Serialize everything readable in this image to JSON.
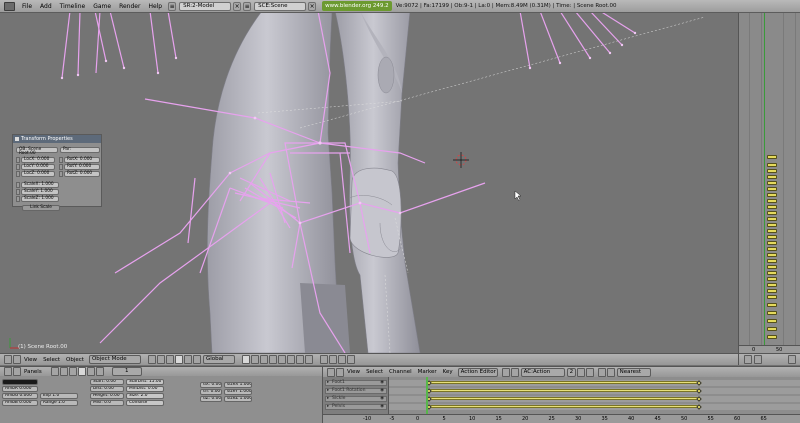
{
  "topbar": {
    "menus": [
      "File",
      "Add",
      "Timeline",
      "Game",
      "Render",
      "Help"
    ],
    "screen_field": "SR:2-Model",
    "scene_field": "SCE:Scene",
    "site_link": "www.blender.org 249.2",
    "stats": "Ve:9072 | Fa:17199 | Ob:9-1 | La:0 | Mem:8.49M (0.31M) | Time: | Scene Root.00"
  },
  "viewport": {
    "label": "(1) Scene Root.00",
    "transform_panel": {
      "title": "Transform Properties",
      "ob_label": "OB: Scene Root.00",
      "par_label": "Par:",
      "loc": [
        "LocX: 0.000",
        "LocY: 0.000",
        "LocZ: 0.000"
      ],
      "rot": [
        "RotX: 0.000",
        "RotY: 0.000",
        "RotZ: 0.000"
      ],
      "scale": [
        "ScaleX: 1.000",
        "ScaleY: 1.000",
        "ScaleZ: 1.000"
      ],
      "link_scale": "Link Scale"
    }
  },
  "view_header": {
    "menus": [
      "View",
      "Select",
      "Object"
    ],
    "mode": "Object Mode",
    "orientation": "Global"
  },
  "right_strip": {
    "axis_labels": [
      "0",
      "50"
    ]
  },
  "buttons_window": {
    "menu": "Panels",
    "frame_field": "1",
    "fields": [
      "AmbR 0.000",
      "AmbG 0.000",
      "AmbB 0.000",
      "Exp 1.0",
      "Range 1.0",
      "Start: 0.00",
      "Dist: 0.00",
      "Height: 0.00",
      "Misi: 0.0",
      "StarDist: 15.00",
      "MinDist: 0.00",
      "Size: 2.0",
      "Colnoise",
      "dX: 0.00",
      "dY: 0.00",
      "dZ: 0.00",
      "sizeX 1.000",
      "sizeY 1.000",
      "sizeZ 1.000"
    ]
  },
  "action_editor": {
    "menus": [
      "View",
      "Select",
      "Channel",
      "Marker",
      "Key"
    ],
    "editor_type": "Action Editor",
    "action": "AC:Action",
    "users": "2",
    "snap": "Nearest",
    "channels": [
      "Foot1",
      "Foot1 Rotation",
      "Sickle",
      "Pelvis"
    ],
    "axis_labels": [
      "-10",
      "-5",
      "0",
      "5",
      "10",
      "15",
      "20",
      "25",
      "30",
      "35",
      "40",
      "45",
      "50",
      "55",
      "60",
      "65"
    ]
  }
}
